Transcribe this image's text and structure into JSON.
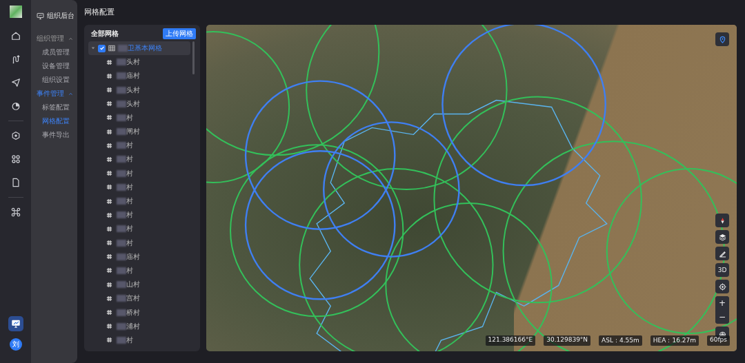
{
  "page_title": "网格配置",
  "rail": {
    "items": [
      {
        "selected": false
      },
      {
        "selected": false
      },
      {
        "selected": false
      },
      {
        "selected": false
      },
      {
        "selected": false
      },
      {
        "selected": false
      },
      {
        "selected": false
      },
      {
        "selected": false
      }
    ],
    "monitor_button": {
      "selected": true
    },
    "avatar": "刘"
  },
  "menu": {
    "header": "组织后台",
    "groups": [
      {
        "label": "组织管理",
        "expanded": true,
        "selected": false,
        "items": [
          {
            "label": "成员管理",
            "selected": false
          },
          {
            "label": "设备管理",
            "selected": false
          },
          {
            "label": "组织设置",
            "selected": false
          }
        ]
      },
      {
        "label": "事件管理",
        "expanded": true,
        "selected": true,
        "items": [
          {
            "label": "标签配置",
            "selected": false
          },
          {
            "label": "网格配置",
            "selected": true
          },
          {
            "label": "事件导出",
            "selected": false
          }
        ]
      }
    ]
  },
  "tree": {
    "title": "全部网格",
    "upload_button": "上传网格",
    "root": {
      "name": "卫基本网格",
      "checked": true,
      "expanded": true,
      "selected": true,
      "children": [
        {
          "name": "头村"
        },
        {
          "name": "庙村"
        },
        {
          "name": "头村"
        },
        {
          "name": "头村"
        },
        {
          "name": "村"
        },
        {
          "name": "闸村"
        },
        {
          "name": "村"
        },
        {
          "name": "村"
        },
        {
          "name": "村"
        },
        {
          "name": "村"
        },
        {
          "name": "村"
        },
        {
          "name": "村"
        },
        {
          "name": "村"
        },
        {
          "name": "村"
        },
        {
          "name": "庙村"
        },
        {
          "name": "村"
        },
        {
          "name": "山村"
        },
        {
          "name": "宫村"
        },
        {
          "name": "桥村"
        },
        {
          "name": "浦村"
        },
        {
          "name": "村"
        }
      ]
    }
  },
  "map": {
    "tools": {
      "label_3d": "3D",
      "zoom_in": "+",
      "zoom_out": "−"
    },
    "status": {
      "longitude": "121.386166°E",
      "latitude": "30.129839°N",
      "asl": "ASL：4.55m",
      "hea": "HEA：16.27m",
      "fps": "60fps"
    }
  }
}
